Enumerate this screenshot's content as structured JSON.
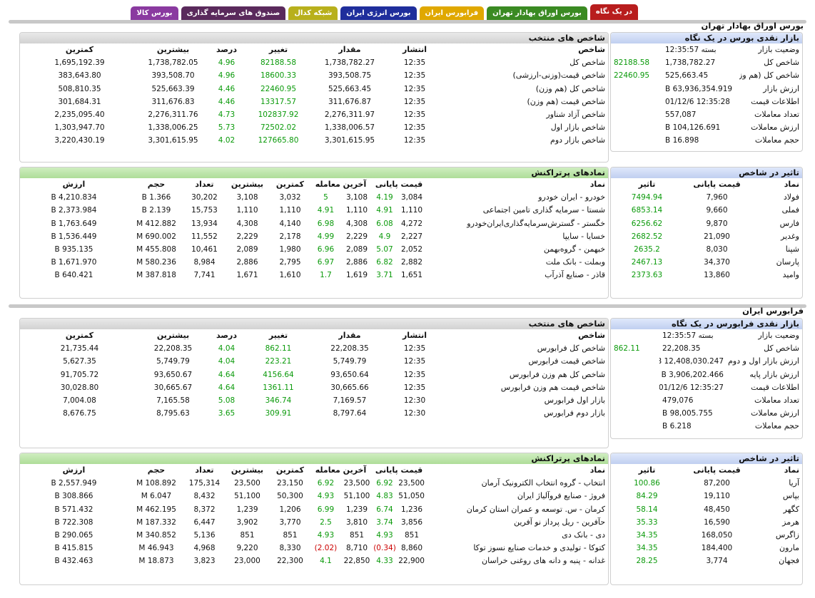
{
  "tabs": [
    {
      "label": "در یک نگاه",
      "color": "#b81d1d",
      "active": true
    },
    {
      "label": "بورس اوراق بهادار تهران",
      "color": "#3a8a22"
    },
    {
      "label": "فرابورس ایران",
      "color": "#e0a800"
    },
    {
      "label": "بورس انرژی ایران",
      "color": "#1f2e9c"
    },
    {
      "label": "شبکه کدال",
      "color": "#b8b01c"
    },
    {
      "label": "صندوق های سرمایه گذاری",
      "color": "#5a2a5c"
    },
    {
      "label": "بورس کالا",
      "color": "#8a3aa0"
    }
  ],
  "tse": {
    "title": "بورس اوراق بهادار تهران",
    "glance": {
      "title": "بازار نقدی بورس در یک نگاه",
      "rows": [
        {
          "k": "وضعیت بازار",
          "v": "بسته 12:35:57",
          "c": ""
        },
        {
          "k": "شاخص کل",
          "v": "1,738,782.27",
          "c": "82188.58"
        },
        {
          "k": "شاخص کل (هم وزن)",
          "v": "525,663.45",
          "c": "22460.95"
        },
        {
          "k": "ارزش بازار",
          "v": "63,936,354.919 B",
          "c": ""
        },
        {
          "k": "اطلاعات قیمت",
          "v": "12:35:28 01/12/6",
          "c": ""
        },
        {
          "k": "تعداد معاملات",
          "v": "557,087",
          "c": ""
        },
        {
          "k": "ارزش معاملات",
          "v": "104,126.691 B",
          "c": ""
        },
        {
          "k": "حجم معاملات",
          "v": "16.898 B",
          "c": ""
        }
      ]
    },
    "indices": {
      "title": "شاخص های منتخب",
      "headers": [
        "شاخص",
        "انتشار",
        "مقدار",
        "تغییر",
        "درصد",
        "بیشترین",
        "کمترین"
      ],
      "rows": [
        [
          "شاخص کل",
          "12:35",
          "1,738,782.27",
          "82188.58",
          "4.96",
          "1,738,782.05",
          "1,695,192.39"
        ],
        [
          "شاخص قیمت(وزنی-ارزشی)",
          "12:35",
          "393,508.75",
          "18600.33",
          "4.96",
          "393,508.70",
          "383,643.80"
        ],
        [
          "شاخص کل (هم وزن)",
          "12:35",
          "525,663.45",
          "22460.95",
          "4.46",
          "525,663.39",
          "508,810.35"
        ],
        [
          "شاخص قیمت (هم وزن)",
          "12:35",
          "311,676.87",
          "13317.57",
          "4.46",
          "311,676.83",
          "301,684.31"
        ],
        [
          "شاخص آزاد شناور",
          "12:35",
          "2,276,311.97",
          "102837.92",
          "4.73",
          "2,276,311.76",
          "2,235,095.40"
        ],
        [
          "شاخص بازار اول",
          "12:35",
          "1,338,006.57",
          "72502.02",
          "5.73",
          "1,338,006.25",
          "1,303,947.70"
        ],
        [
          "شاخص بازار دوم",
          "12:35",
          "3,301,615.95",
          "127665.80",
          "4.02",
          "3,301,615.95",
          "3,220,430.19"
        ]
      ]
    },
    "impact": {
      "title": "تاثیر در شاخص",
      "headers": [
        "نماد",
        "قیمت پایانی",
        "تاثیر"
      ],
      "rows": [
        [
          "فولاد",
          "7,960",
          "7494.94"
        ],
        [
          "فملی",
          "9,660",
          "6853.14"
        ],
        [
          "فارس",
          "9,870",
          "6256.62"
        ],
        [
          "وغدیر",
          "21,090",
          "2682.52"
        ],
        [
          "شپنا",
          "8,030",
          "2635.2"
        ],
        [
          "پارسان",
          "34,370",
          "2467.13"
        ],
        [
          "وامید",
          "13,860",
          "2373.63"
        ]
      ]
    },
    "active": {
      "title": "نمادهای پرتراکنش",
      "headers": [
        "نماد",
        "قیمت پایانی",
        "آخرین معامله",
        "کمترین",
        "بیشترین",
        "تعداد",
        "حجم",
        "ارزش"
      ],
      "rows": [
        [
          "خودرو - ایران خودرو",
          "3,084",
          "4.19",
          "3,108",
          "5",
          "3,032",
          "3,108",
          "30,202",
          "1.366 B",
          "4,210.834 B"
        ],
        [
          "شستا - سرمایه گذاری تامین اجتماعی",
          "1,110",
          "4.91",
          "1,110",
          "4.91",
          "1,110",
          "1,110",
          "15,753",
          "2.139 B",
          "2,373.984 B"
        ],
        [
          "خگستر - گسترش‌سرمایه‌گذاری‌ایران‌خودرو",
          "4,272",
          "6.08",
          "4,308",
          "6.98",
          "4,140",
          "4,308",
          "13,934",
          "412.882 M",
          "1,763.649 B"
        ],
        [
          "خسایا - سایپا",
          "2,227",
          "4.9",
          "2,229",
          "4.99",
          "2,178",
          "2,229",
          "11,552",
          "690.002 M",
          "1,536.449 B"
        ],
        [
          "خبهمن - گروه‌بهمن",
          "2,052",
          "5.07",
          "2,089",
          "6.96",
          "1,980",
          "2,089",
          "10,461",
          "455.808 M",
          "935.135 B"
        ],
        [
          "وبملت - بانک ملت",
          "2,882",
          "6.82",
          "2,886",
          "6.97",
          "2,795",
          "2,886",
          "8,984",
          "580.236 M",
          "1,671.970 B"
        ],
        [
          "قاذر - صنایع آذرآب",
          "1,651",
          "3.71",
          "1,619",
          "1.7",
          "1,610",
          "1,671",
          "7,741",
          "387.818 M",
          "640.421 B"
        ]
      ]
    }
  },
  "ifb": {
    "title": "فرابورس ایران",
    "glance": {
      "title": "بازار نقدی فرابورس در یک نگاه",
      "rows": [
        {
          "k": "وضعیت بازار",
          "v": "بسته 12:35:57",
          "c": ""
        },
        {
          "k": "شاخص کل",
          "v": "22,208.35",
          "c": "862.11"
        },
        {
          "k": "ارزش بازار اول و دوم",
          "v": "12,408,030.247 B",
          "c": ""
        },
        {
          "k": "ارزش بازار پایه",
          "v": "3,906,202.466 B",
          "c": ""
        },
        {
          "k": "اطلاعات قیمت",
          "v": "12:35:27 01/12/6",
          "c": ""
        },
        {
          "k": "تعداد معاملات",
          "v": "479,076",
          "c": ""
        },
        {
          "k": "ارزش معاملات",
          "v": "98,005.755 B",
          "c": ""
        },
        {
          "k": "حجم معاملات",
          "v": "6.218 B",
          "c": ""
        }
      ]
    },
    "indices": {
      "title": "شاخص های منتخب",
      "headers": [
        "شاخص",
        "انتشار",
        "مقدار",
        "تغییر",
        "درصد",
        "بیشترین",
        "کمترین"
      ],
      "rows": [
        [
          "شاخص کل فرابورس",
          "12:35",
          "22,208.35",
          "862.11",
          "4.04",
          "22,208.35",
          "21,735.44"
        ],
        [
          "شاخص قیمت فرابورس",
          "12:35",
          "5,749.79",
          "223.21",
          "4.04",
          "5,749.79",
          "5,627.35"
        ],
        [
          "شاخص کل هم وزن فرابورس",
          "12:35",
          "93,650.64",
          "4156.64",
          "4.64",
          "93,650.67",
          "91,705.72"
        ],
        [
          "شاخص قیمت هم وزن فرابورس",
          "12:35",
          "30,665.66",
          "1361.11",
          "4.64",
          "30,665.67",
          "30,028.80"
        ],
        [
          "بازار اول فرابورس",
          "12:30",
          "7,169.57",
          "346.74",
          "5.08",
          "7,165.58",
          "7,004.08"
        ],
        [
          "بازار دوم فرابورس",
          "12:30",
          "8,797.64",
          "309.91",
          "3.65",
          "8,795.63",
          "8,676.75"
        ]
      ]
    },
    "impact": {
      "title": "تاثیر در شاخص",
      "headers": [
        "نماد",
        "قیمت پایانی",
        "تاثیر"
      ],
      "rows": [
        [
          "آریا",
          "87,200",
          "100.86"
        ],
        [
          "بپاس",
          "19,110",
          "84.29"
        ],
        [
          "کگهر",
          "48,450",
          "58.14"
        ],
        [
          "هرمز",
          "16,590",
          "35.33"
        ],
        [
          "زاگرس",
          "168,050",
          "34.35"
        ],
        [
          "مارون",
          "184,400",
          "34.35"
        ],
        [
          "فجهان",
          "3,774",
          "28.25"
        ]
      ]
    },
    "active": {
      "title": "نمادهای پرتراکنش",
      "headers": [
        "نماد",
        "قیمت پایانی",
        "آخرین معامله",
        "کمترین",
        "بیشترین",
        "تعداد",
        "حجم",
        "ارزش"
      ],
      "rows": [
        [
          "انتخاب - گروه انتخاب الکترونیک آرمان",
          "23,500",
          "6.92",
          "23,500",
          "6.92",
          "23,150",
          "23,500",
          "175,314",
          "108.892 M",
          "2,557.949 B"
        ],
        [
          "فروژ - صنایع فروآلیاژ ایران",
          "51,050",
          "4.83",
          "51,100",
          "4.93",
          "50,300",
          "51,100",
          "8,432",
          "6.047 M",
          "308.866 B"
        ],
        [
          "کرمان - س. توسعه و عمران استان کرمان",
          "1,236",
          "6.74",
          "1,239",
          "6.99",
          "1,206",
          "1,239",
          "8,372",
          "462.195 M",
          "571.432 B"
        ],
        [
          "حآفرین - ریل پرداز نو آفرین",
          "3,856",
          "3.74",
          "3,810",
          "2.5",
          "3,770",
          "3,902",
          "6,447",
          "187.332 M",
          "722.308 B"
        ],
        [
          "دی - بانک دی",
          "851",
          "4.93",
          "851",
          "4.93",
          "851",
          "851",
          "5,136",
          "340.852 M",
          "290.065 B"
        ],
        [
          "کتوکا - تولیدی و خدمات صنایع نسوز توکا",
          "8,860",
          "(0.34)",
          "8,710",
          "(2.02)",
          "8,330",
          "9,220",
          "4,968",
          "46.943 M",
          "415.815 B"
        ],
        [
          "غدانه - پنبه و دانه های روغنی خراسان",
          "22,900",
          "4.33",
          "22,850",
          "4.1",
          "22,300",
          "23,000",
          "3,823",
          "18.873 M",
          "432.463 B"
        ]
      ]
    }
  }
}
